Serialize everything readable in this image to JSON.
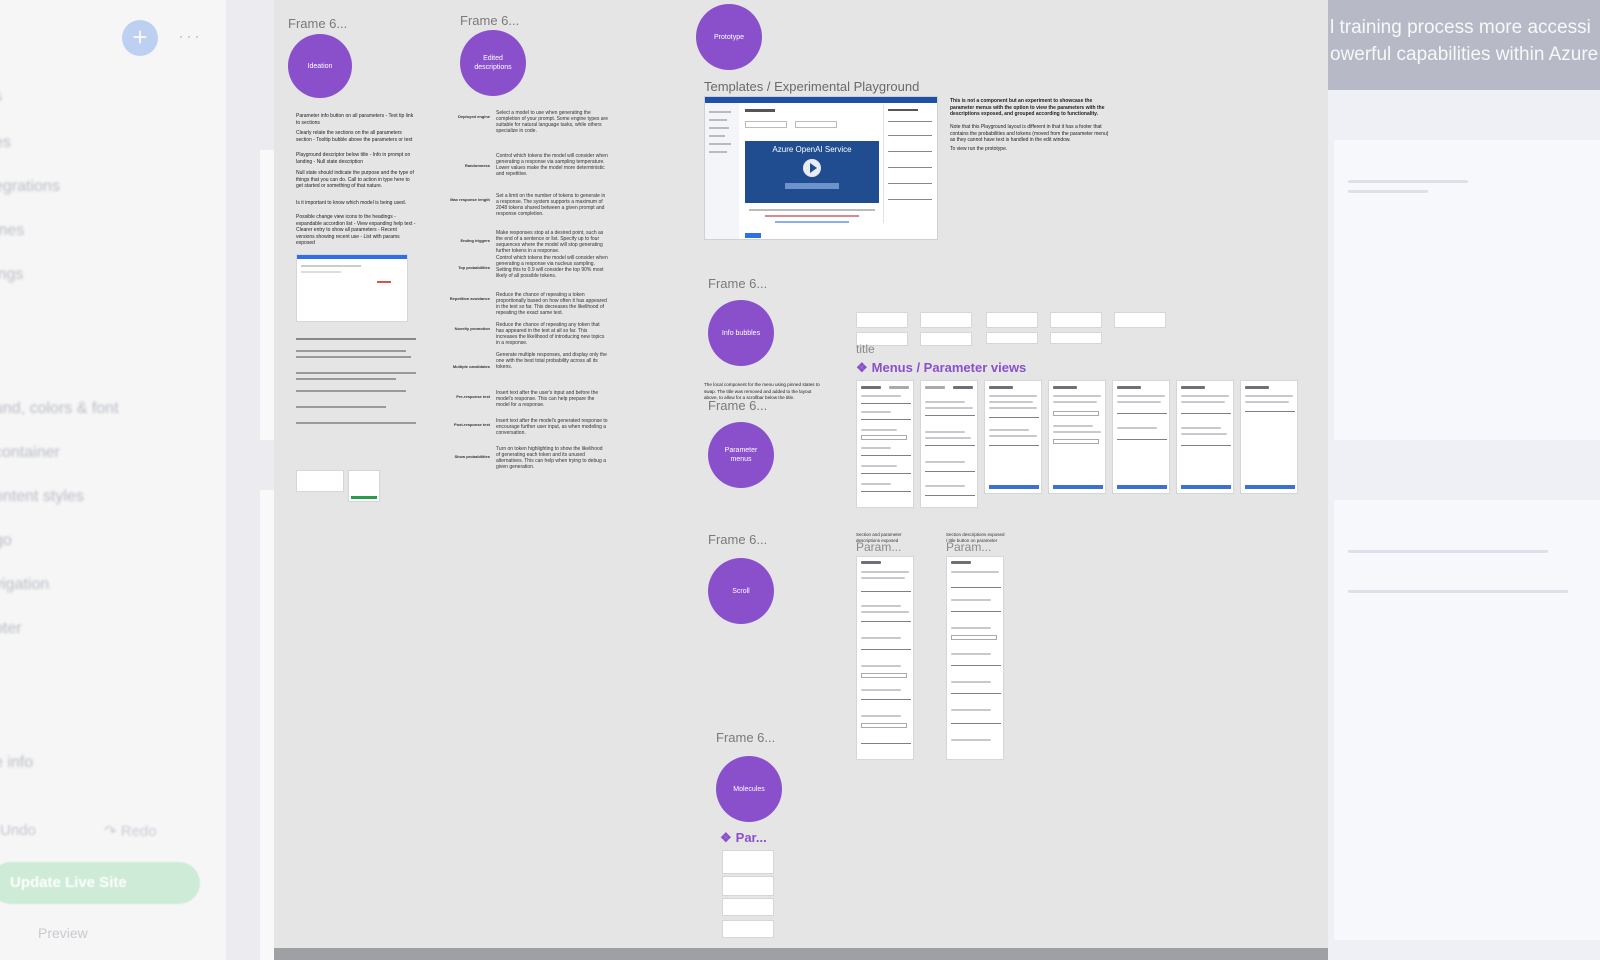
{
  "left_panel": {
    "menu_items": [
      "s",
      "es",
      "egrations",
      "mes",
      "ings",
      "und, colors & font",
      "container",
      "ontent styles",
      "go",
      "vigation",
      "oter",
      "e info"
    ],
    "undo_label": "Undo",
    "redo_label": "Redo",
    "update_button": "Update Live Site",
    "preview_link": "Preview"
  },
  "right_panel": {
    "hero_line1": "l training process more accessi",
    "hero_line2": "owerful capabilities within Azure."
  },
  "canvas": {
    "frame_labels": [
      "Frame 6...",
      "Frame 6...",
      "Frame 6...",
      "Frame 6...",
      "Frame 6...",
      "Frame 6..."
    ],
    "bubbles": {
      "ideation": "Ideation",
      "edited_descriptions": "Edited descriptions",
      "prototype": "Prototype",
      "info_bubbles": "Info bubbles",
      "parameter_menus": "Parameter menus",
      "scroll": "Scroll",
      "molecules": "Molecules"
    },
    "templates_title": "Templates / Experimental Playground",
    "azure_video_title": "Azure OpenAI Service",
    "playground_note": "This is not a component but an experiment to showcase the parameter menus with the option to view the parameters with the descriptions exposed, and grouped according to functionality.",
    "playground_note2": "Note that this Playground layout is different in that it has a footer that contains the probabilities and tokens (moved from the parameter menu) as they cannot have text is handled in the edit window.",
    "playground_note3": "To view run the prototype.",
    "title_small": "title",
    "menus_title": "Menus / Parameter views",
    "menus_note": "The local component for the menu using pinned states to swap. The title was removed and added to the layout above, to allow for a scrollbar below the title.",
    "param_labels": [
      "Param...",
      "Param..."
    ],
    "param_sub1": "Section and parameter descriptions exposed",
    "param_sub2": "Section descriptions exposed / title button on parameter",
    "par_title": "Par...",
    "ideation_notes": [
      "Parameter info button on all parameters - Text tip link to sections",
      "Clearly relate the sections on the all parameters section - Tooltip bubble above the parameters or text",
      "Playground descriptor below title - Info in prompt on landing - Null state description",
      "Null state should indicate the purpose and the type of things that you can do. Call to action in type here to get started or something of that nature.",
      "Is it important to know which model is being used.",
      "Possible change view icons to the headings - expandable accordion list - View expanding help text - Clearer entry to show all parameters - Recent versions showing recent use - List with params exposed"
    ],
    "param_names": [
      "Deployed engine",
      "Randomness",
      "Max response length",
      "Ending triggers",
      "Top probabilities",
      "Repetition avoidance",
      "Novelty promotion",
      "Multiple candidates",
      "Pre-response text",
      "Post-response text",
      "Show probabilities"
    ],
    "param_descs": [
      "Select a model to use when generating the completion of your prompt. Some engine types are suitable for natural language tasks, while others specialize in code.",
      "Control which tokens the model will consider when generating a response via sampling temperature. Lower values make the model more deterministic and repetitive.",
      "Set a limit on the number of tokens to generate in a response. The system supports a maximum of 2048 tokens shared between a given prompt and response completion.",
      "Make responses stop at a desired point, such as the end of a sentence or list. Specify up to four sequences where the model will stop generating further tokens in a response.",
      "Control which tokens the model will consider when generating a response via nucleus sampling. Setting this to 0.9 will consider the top 90% most likely of all possible tokens.",
      "Reduce the chance of repeating a token proportionally based on how often it has appeared in the text so far. This decreases the likelihood of repeating the exact same text.",
      "Reduce the chance of repeating any token that has appeared in the text at all so far. This increases the likelihood of introducing new topics in a response.",
      "Generate multiple responses, and display only the one with the best total probability across all its tokens.",
      "Insert text after the user's input and before the model's response. This can help prepare the model for a response.",
      "Insert text after the model's generated response to encourage further user input, as when modeling a conversation.",
      "Turn on token highlighting to show the likelihood of generating each token and its unused alternatives. This can help when trying to debug a given generation."
    ]
  },
  "colors": {
    "bubble": "#8a50cc",
    "canvas": "#e5e5e6",
    "accent_blue": "#2f6fe8",
    "update_green": "#cdebd6"
  },
  "icons": {
    "add": "plus-icon",
    "more": "more-dots-icon",
    "redo": "redo-icon",
    "component": "component-diamond-icon",
    "play": "play-icon"
  }
}
